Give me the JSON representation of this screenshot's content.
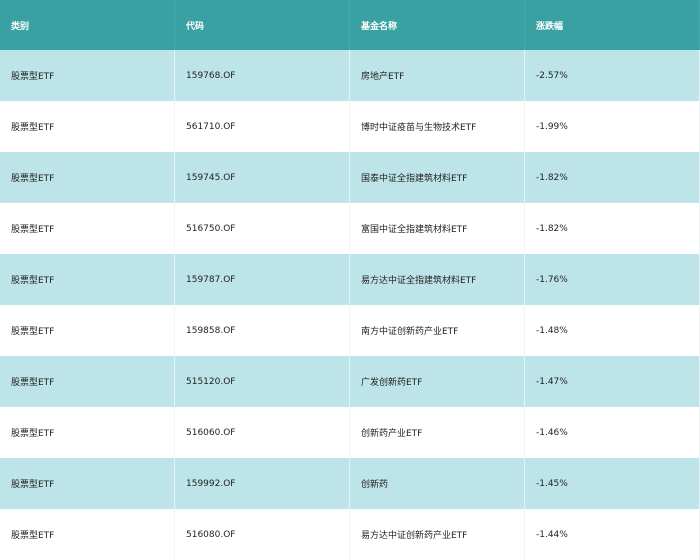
{
  "table": {
    "headers": [
      "类别",
      "代码",
      "基金名称",
      "涨跌幅"
    ],
    "rows": [
      [
        "股票型ETF",
        "159768.OF",
        "房地产ETF",
        "-2.57%"
      ],
      [
        "股票型ETF",
        "561710.OF",
        "博时中证疫苗与生物技术ETF",
        "-1.99%"
      ],
      [
        "股票型ETF",
        "159745.OF",
        "国泰中证全指建筑材料ETF",
        "-1.82%"
      ],
      [
        "股票型ETF",
        "516750.OF",
        "富国中证全指建筑材料ETF",
        "-1.82%"
      ],
      [
        "股票型ETF",
        "159787.OF",
        "易方达中证全指建筑材料ETF",
        "-1.76%"
      ],
      [
        "股票型ETF",
        "159858.OF",
        "南方中证创新药产业ETF",
        "-1.48%"
      ],
      [
        "股票型ETF",
        "515120.OF",
        "广发创新药ETF",
        "-1.47%"
      ],
      [
        "股票型ETF",
        "516060.OF",
        "创新药产业ETF",
        "-1.46%"
      ],
      [
        "股票型ETF",
        "159992.OF",
        "创新药",
        "-1.45%"
      ],
      [
        "股票型ETF",
        "516080.OF",
        "易方达中证创新药产业ETF",
        "-1.44%"
      ]
    ]
  },
  "colors": {
    "header_bg": "#3aa1a3",
    "row_odd_bg": "#bde4e8",
    "row_even_bg": "#ffffff"
  }
}
